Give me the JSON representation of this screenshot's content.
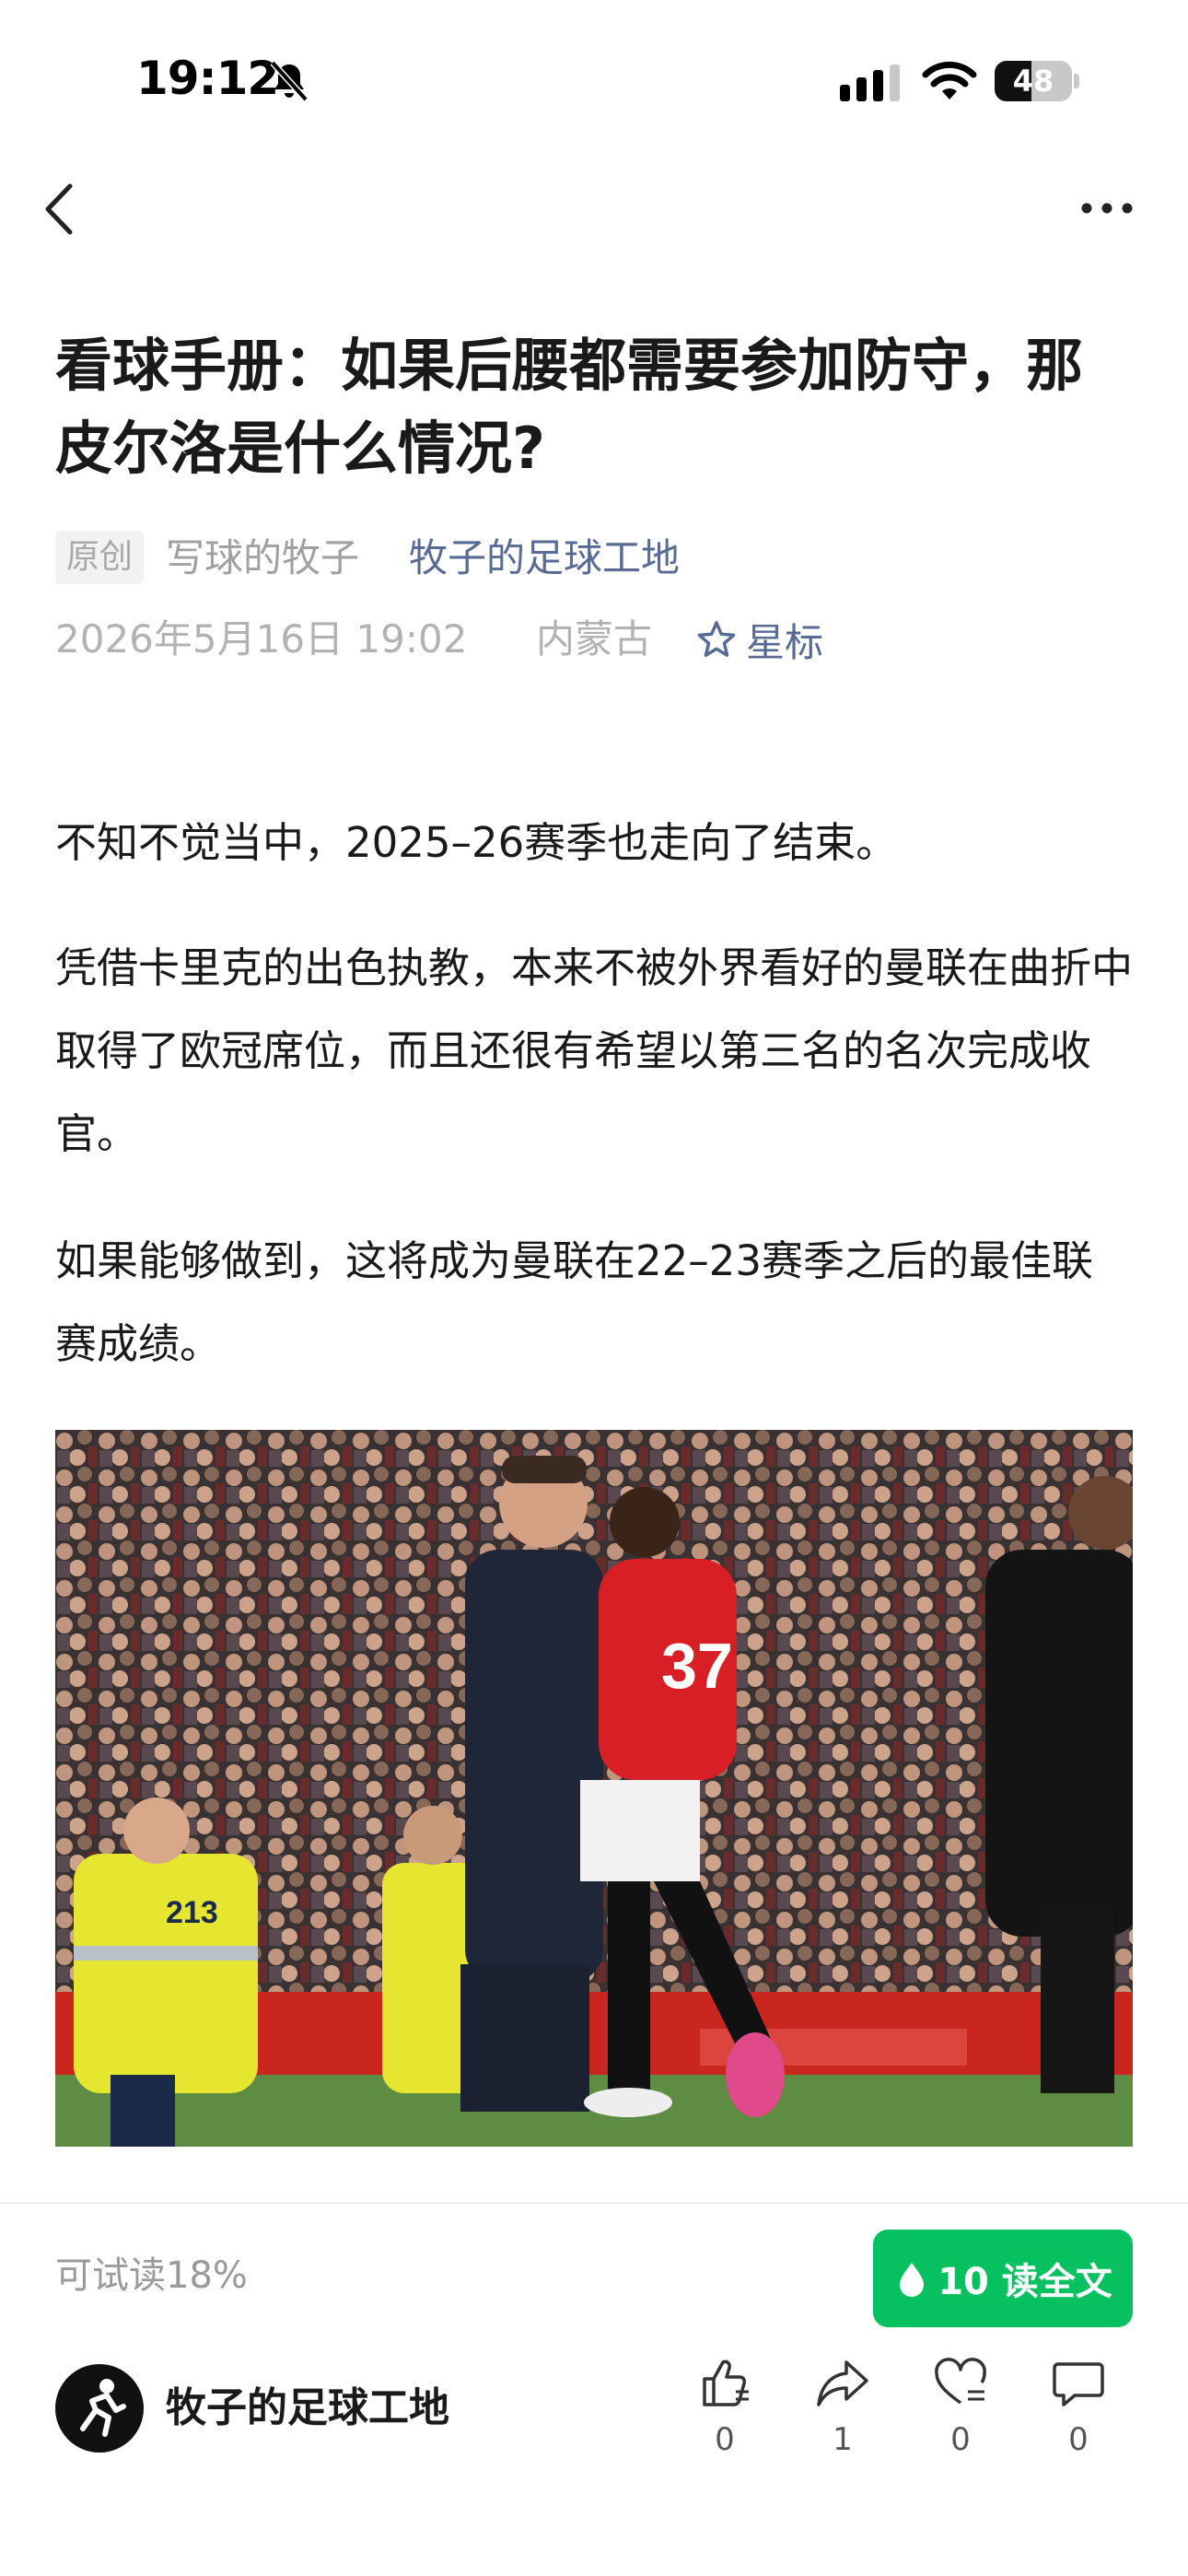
{
  "status_bar": {
    "time": "19:12",
    "battery_level": 48,
    "battery_text": "48"
  },
  "nav": {
    "back_icon": "chevron-left-icon",
    "more_icon": "more-dots-icon"
  },
  "article": {
    "title": "看球手册：如果后腰都需要参加防守，那皮尔洛是什么情况?",
    "badge": "原创",
    "author": "写球的牧子",
    "account": "牧子的足球工地",
    "date": "2026年5月16日 19:02",
    "location": "内蒙古",
    "star_label": "星标",
    "paragraphs": [
      "不知不觉当中，2025–26赛季也走向了结束。",
      "凭借卡里克的出色执教，本来不被外界看好的曼联在曲折中取得了欧冠席位，而且还很有希望以第三名的名次完成收官。",
      "如果能够做到，这将成为曼联在22–23赛季之后的最佳联赛成绩。"
    ],
    "photo_shirt_number": "37",
    "photo_sign_number": "213"
  },
  "paywall": {
    "trial_text": "可试读18%",
    "read_button": "10 读全文",
    "accent": "#07c160"
  },
  "footer": {
    "account_name": "牧子的足球工地",
    "actions": [
      {
        "name": "like",
        "icon": "thumbs-up-icon",
        "count": "0"
      },
      {
        "name": "share",
        "icon": "share-icon",
        "count": "1"
      },
      {
        "name": "wow",
        "icon": "heart-icon",
        "count": "0"
      },
      {
        "name": "comment",
        "icon": "comment-icon",
        "count": "0"
      }
    ]
  },
  "colors": {
    "link": "#576b95",
    "muted": "#b2b2b2",
    "text": "#1a1a1a"
  }
}
